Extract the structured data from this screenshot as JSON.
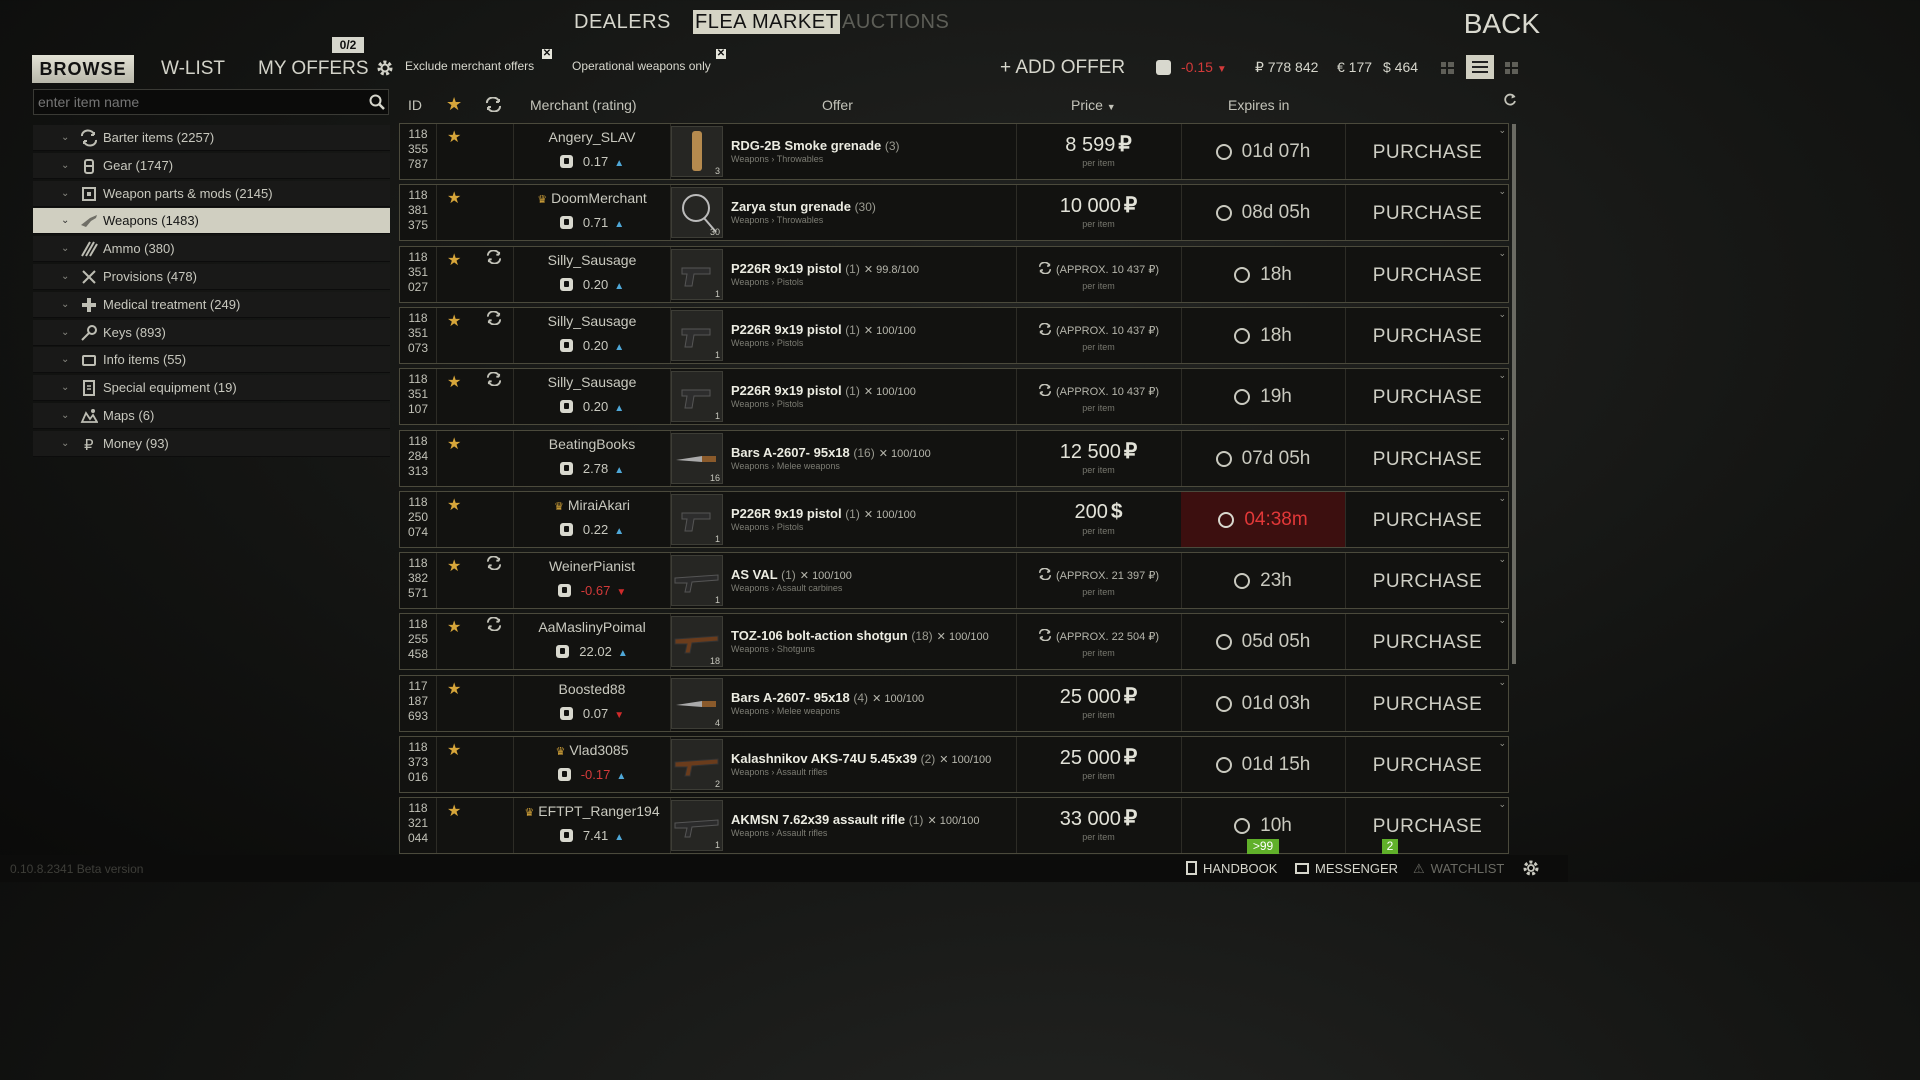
{
  "top_tabs": {
    "dealers": "DEALERS",
    "flea": "FLEA MARKET",
    "auctions": "AUCTIONS",
    "back": "BACK"
  },
  "sub_tabs": {
    "browse": "BROWSE",
    "wlist": "W-LIST",
    "my_offers": "MY OFFERS",
    "my_offers_count": "0/2"
  },
  "filters": {
    "exclude": "Exclude merchant offers",
    "operational": "Operational weapons only"
  },
  "add_offer": "+ ADD OFFER",
  "rating": {
    "value": "-0.15"
  },
  "balance": {
    "rub": "₽ 778 842",
    "eur": "€ 177",
    "usd": "$ 464"
  },
  "search": {
    "placeholder": "enter item name"
  },
  "categories": [
    {
      "label": "Barter items (2257)",
      "icon": "barter-icon"
    },
    {
      "label": "Gear (1747)",
      "icon": "gear-icon"
    },
    {
      "label": "Weapon parts & mods (2145)",
      "icon": "mods-icon"
    },
    {
      "label": "Weapons (1483)",
      "icon": "weapon-icon"
    },
    {
      "label": "Ammo (380)",
      "icon": "ammo-icon"
    },
    {
      "label": "Provisions (478)",
      "icon": "provisions-icon"
    },
    {
      "label": "Medical treatment (249)",
      "icon": "medical-icon"
    },
    {
      "label": "Keys (893)",
      "icon": "key-icon"
    },
    {
      "label": "Info items (55)",
      "icon": "info-icon"
    },
    {
      "label": "Special equipment (19)",
      "icon": "special-icon"
    },
    {
      "label": "Maps (6)",
      "icon": "map-icon"
    },
    {
      "label": "Money (93)",
      "icon": "money-icon"
    }
  ],
  "columns": {
    "id": "ID",
    "merchant": "Merchant (rating)",
    "offer": "Offer",
    "price": "Price",
    "expires": "Expires in"
  },
  "purchase_label": "PURCHASE",
  "per_item": "per item",
  "offers": [
    {
      "id1": "118",
      "id2": "355",
      "id3": "787",
      "barter": false,
      "crown": false,
      "merchant": "Angery_SLAV",
      "rating": "0.17",
      "trend": "up",
      "item": "RDG-2B Smoke grenade",
      "qty": "(3)",
      "durability": "",
      "category": "Weapons › Throwables",
      "stack": "3",
      "price": "8 599",
      "currency": "₽",
      "expires": "01d 07h",
      "urgent": false
    },
    {
      "id1": "118",
      "id2": "381",
      "id3": "375",
      "barter": false,
      "crown": true,
      "merchant": "DoomMerchant",
      "rating": "0.71",
      "trend": "up",
      "item": "Zarya stun grenade",
      "qty": "(30)",
      "durability": "",
      "category": "Weapons › Throwables",
      "stack": "30",
      "price": "10 000",
      "currency": "₽",
      "expires": "08d 05h",
      "urgent": false
    },
    {
      "id1": "118",
      "id2": "351",
      "id3": "027",
      "barter": true,
      "crown": false,
      "merchant": "Silly_Sausage",
      "rating": "0.20",
      "trend": "up",
      "item": "P226R 9x19 pistol",
      "qty": "(1)",
      "durability": "99.8/100",
      "category": "Weapons › Pistols",
      "stack": "1",
      "price": "(APPROX. 10 437 ₽)",
      "currency": "",
      "expires": "18h",
      "urgent": false
    },
    {
      "id1": "118",
      "id2": "351",
      "id3": "073",
      "barter": true,
      "crown": false,
      "merchant": "Silly_Sausage",
      "rating": "0.20",
      "trend": "up",
      "item": "P226R 9x19 pistol",
      "qty": "(1)",
      "durability": "100/100",
      "category": "Weapons › Pistols",
      "stack": "1",
      "price": "(APPROX. 10 437 ₽)",
      "currency": "",
      "expires": "18h",
      "urgent": false
    },
    {
      "id1": "118",
      "id2": "351",
      "id3": "107",
      "barter": true,
      "crown": false,
      "merchant": "Silly_Sausage",
      "rating": "0.20",
      "trend": "up",
      "item": "P226R 9x19 pistol",
      "qty": "(1)",
      "durability": "100/100",
      "category": "Weapons › Pistols",
      "stack": "1",
      "price": "(APPROX. 10 437 ₽)",
      "currency": "",
      "expires": "19h",
      "urgent": false
    },
    {
      "id1": "118",
      "id2": "284",
      "id3": "313",
      "barter": false,
      "crown": false,
      "merchant": "BeatingBooks",
      "rating": "2.78",
      "trend": "up",
      "item": "Bars A-2607- 95x18",
      "qty": "(16)",
      "durability": "100/100",
      "category": "Weapons › Melee weapons",
      "stack": "16",
      "price": "12 500",
      "currency": "₽",
      "expires": "07d 05h",
      "urgent": false
    },
    {
      "id1": "118",
      "id2": "250",
      "id3": "074",
      "barter": false,
      "crown": true,
      "merchant": "MiraiAkari",
      "rating": "0.22",
      "trend": "up",
      "item": "P226R 9x19 pistol",
      "qty": "(1)",
      "durability": "100/100",
      "category": "Weapons › Pistols",
      "stack": "1",
      "price": "200",
      "currency": "$",
      "expires": "04:38m",
      "urgent": true
    },
    {
      "id1": "118",
      "id2": "382",
      "id3": "571",
      "barter": true,
      "crown": false,
      "merchant": "WeinerPianist",
      "rating": "-0.67",
      "trend": "down",
      "item": "AS VAL",
      "qty": "(1)",
      "durability": "100/100",
      "category": "Weapons › Assault carbines",
      "stack": "1",
      "price": "(APPROX. 21 397 ₽)",
      "currency": "",
      "expires": "23h",
      "urgent": false
    },
    {
      "id1": "118",
      "id2": "255",
      "id3": "458",
      "barter": true,
      "crown": false,
      "merchant": "AaMaslinyPoimal",
      "rating": "22.02",
      "trend": "up",
      "item": "TOZ-106 bolt-action shotgun",
      "qty": "(18)",
      "durability": "100/100",
      "category": "Weapons › Shotguns",
      "stack": "18",
      "price": "(APPROX. 22 504 ₽)",
      "currency": "",
      "expires": "05d 05h",
      "urgent": false
    },
    {
      "id1": "117",
      "id2": "187",
      "id3": "693",
      "barter": false,
      "crown": false,
      "merchant": "Boosted88",
      "rating": "0.07",
      "trend": "down",
      "item": "Bars A-2607- 95x18",
      "qty": "(4)",
      "durability": "100/100",
      "category": "Weapons › Melee weapons",
      "stack": "4",
      "price": "25 000",
      "currency": "₽",
      "expires": "01d 03h",
      "urgent": false
    },
    {
      "id1": "118",
      "id2": "373",
      "id3": "016",
      "barter": false,
      "crown": true,
      "merchant": "Vlad3085",
      "rating": "-0.17",
      "trend": "up",
      "item": "Kalashnikov AKS-74U 5.45x39",
      "qty": "(2)",
      "durability": "100/100",
      "category": "Weapons › Assault rifles",
      "stack": "2",
      "price": "25 000",
      "currency": "₽",
      "expires": "01d 15h",
      "urgent": false
    },
    {
      "id1": "118",
      "id2": "321",
      "id3": "044",
      "barter": false,
      "crown": true,
      "merchant": "EFTPT_Ranger194",
      "rating": "7.41",
      "trend": "up",
      "item": "AKMSN 7.62x39 assault rifle",
      "qty": "(1)",
      "durability": "100/100",
      "category": "Weapons › Assault rifles",
      "stack": "1",
      "price": "33 000",
      "currency": "₽",
      "expires": "10h",
      "urgent": false
    }
  ],
  "footer": {
    "version": "0.10.8.2341 Beta version",
    "handbook": "HANDBOOK",
    "messenger": "MESSENGER",
    "watchlist": "WATCHLIST",
    "messenger_badge": ">99",
    "watchlist_badge": "2"
  },
  "colors": {
    "accent": "#d7a63a",
    "active_tab": "#d5d4c5",
    "negative": "#d33a3a",
    "positive": "#4fa8d8",
    "badge": "#60b02a"
  }
}
